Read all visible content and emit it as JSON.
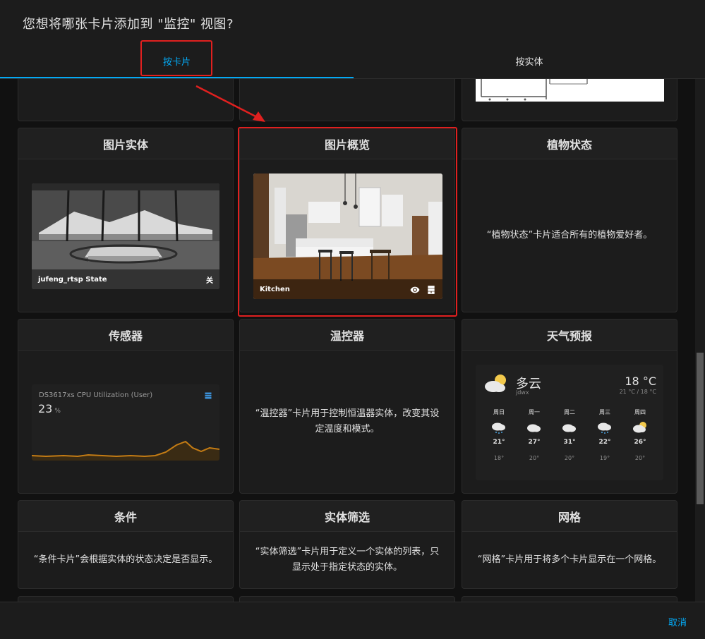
{
  "dialog": {
    "title": "您想将哪张卡片添加到 \"监控\" 视图?",
    "tabs": [
      {
        "label": "按卡片",
        "active": true
      },
      {
        "label": "按实体",
        "active": false
      }
    ],
    "cancel_label": "取消"
  },
  "colors": {
    "accent": "#03a9f4",
    "highlight": "#e0201f",
    "background": "#111111",
    "card": "#1c1c1c",
    "sensor_line": "#c47c14"
  },
  "cards": {
    "picture_entity": {
      "title": "图片实体",
      "entity": "jufeng_rtsp State",
      "state": "关"
    },
    "picture_glance": {
      "title": "图片概览",
      "label": "Kitchen",
      "icons": [
        "eye-icon",
        "server-icon"
      ]
    },
    "plant_status": {
      "title": "植物状态",
      "description": "“植物状态”卡片适合所有的植物爱好者。"
    },
    "sensor": {
      "title": "传感器",
      "name": "DS3617xs CPU Utilization (User)",
      "value": "23",
      "unit": "%",
      "icon": "server-icon"
    },
    "thermostat": {
      "title": "温控器",
      "description": "“温控器”卡片用于控制恒温器实体，改变其设定温度和模式。"
    },
    "weather_forecast": {
      "title": "天气预报",
      "state": "多云",
      "name": "jdwx",
      "temperature": "18 °C",
      "range": "21 °C / 18 °C",
      "forecast": [
        {
          "day": "周日",
          "icon": "rainy-cloud-icon",
          "high": "21°",
          "low": "18°"
        },
        {
          "day": "周一",
          "icon": "cloudy-icon",
          "high": "27°",
          "low": "20°"
        },
        {
          "day": "周二",
          "icon": "cloudy-icon",
          "high": "31°",
          "low": "20°"
        },
        {
          "day": "周三",
          "icon": "rainy-cloud-icon",
          "high": "22°",
          "low": "19°"
        },
        {
          "day": "周四",
          "icon": "partly-cloudy-icon",
          "high": "26°",
          "low": "20°"
        }
      ]
    },
    "conditional": {
      "title": "条件",
      "description": "“条件卡片”会根据实体的状态决定是否显示。"
    },
    "entity_filter": {
      "title": "实体筛选",
      "description": "“实体筛选”卡片用于定义一个实体的列表，只显示处于指定状态的实体。"
    },
    "grid": {
      "title": "网格",
      "description": "“网格”卡片用于将多个卡片显示在一个网格。"
    }
  }
}
